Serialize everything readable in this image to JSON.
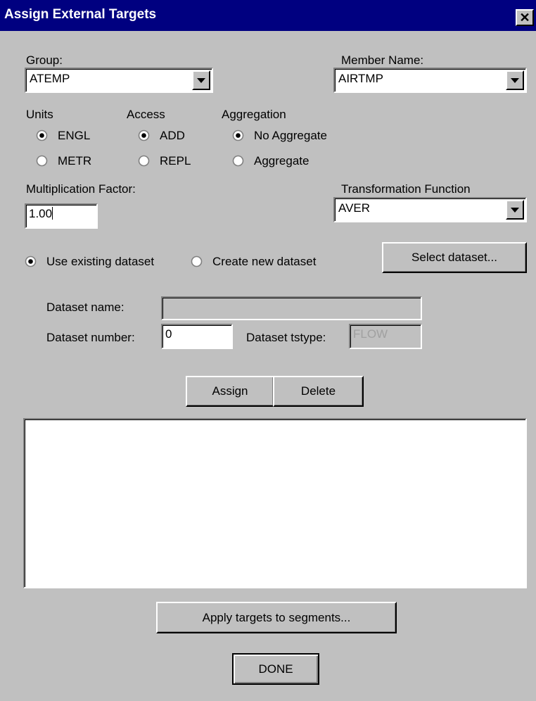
{
  "window": {
    "title": "Assign External Targets",
    "close_symbol": "✕"
  },
  "group": {
    "label": "Group:",
    "value": "ATEMP"
  },
  "member": {
    "label": "Member Name:",
    "value": "AIRTMP"
  },
  "units": {
    "label": "Units",
    "options": [
      "ENGL",
      "METR"
    ],
    "selected": "ENGL"
  },
  "access": {
    "label": "Access",
    "options": [
      "ADD",
      "REPL"
    ],
    "selected": "ADD"
  },
  "aggregation": {
    "label": "Aggregation",
    "options": [
      "No Aggregate",
      "Aggregate"
    ],
    "selected": "No Aggregate"
  },
  "multiplication": {
    "label": "Multiplication Factor:",
    "value": "1.00"
  },
  "transformation": {
    "label": "Transformation Function",
    "value": "AVER"
  },
  "dataset_mode": {
    "options": [
      "Use existing dataset",
      "Create new dataset"
    ],
    "selected": "Use existing dataset"
  },
  "buttons": {
    "select_dataset": "Select dataset...",
    "assign": "Assign",
    "delete": "Delete",
    "apply": "Apply targets to segments...",
    "done": "DONE"
  },
  "dataset": {
    "name_label": "Dataset name:",
    "name_value": "",
    "number_label": "Dataset number:",
    "number_value": "0",
    "tstype_label": "Dataset tstype:",
    "tstype_value": "FLOW"
  },
  "target_list": []
}
